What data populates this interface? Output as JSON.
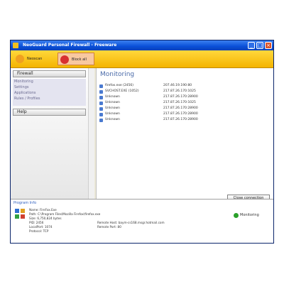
{
  "window": {
    "title": "NeoGuard Personal Firewall - Freeware"
  },
  "toolbar": {
    "buttons": [
      {
        "label": "Neoscan"
      },
      {
        "label": "Block all"
      }
    ]
  },
  "sidebar": {
    "firewall_header": "Firewall",
    "items": [
      {
        "label": "Monitoring"
      },
      {
        "label": "Settings"
      },
      {
        "label": "Applications"
      },
      {
        "label": "Rules / Profiles"
      }
    ],
    "help_header": "Help"
  },
  "main": {
    "title": "Monitoring",
    "connections": [
      {
        "name": "firefox.exe (2456)",
        "address": "207.46.19.190:80"
      },
      {
        "name": "SVCHOST.EXE (1052)",
        "address": "217.87.26.170:1025"
      },
      {
        "name": "Unknown",
        "address": "217.87.26.170:28900"
      },
      {
        "name": "Unknown",
        "address": "217.87.26.170:1025"
      },
      {
        "name": "Unknown",
        "address": "217.87.26.170:28900"
      },
      {
        "name": "Unknown",
        "address": "217.87.26.170:28900"
      },
      {
        "name": "Unknown",
        "address": "217.87.26.170:28900"
      }
    ],
    "close_button": "Close connection"
  },
  "program_info": {
    "link": "Program Info",
    "lines_left": [
      "Name: FireFox.Exe",
      "Path: C:\\Program Files\\Mozilla Firefox\\firefox.exe",
      "Size: 6,750,824 bytes",
      "PID: 2456",
      "LocalPort: 1074",
      "Protocol: TCP"
    ],
    "lines_right": [
      "Remote Host: baym-cs168.msgr.hotmail.com",
      "Remote Port: 80"
    ],
    "status": "Monitoring"
  }
}
